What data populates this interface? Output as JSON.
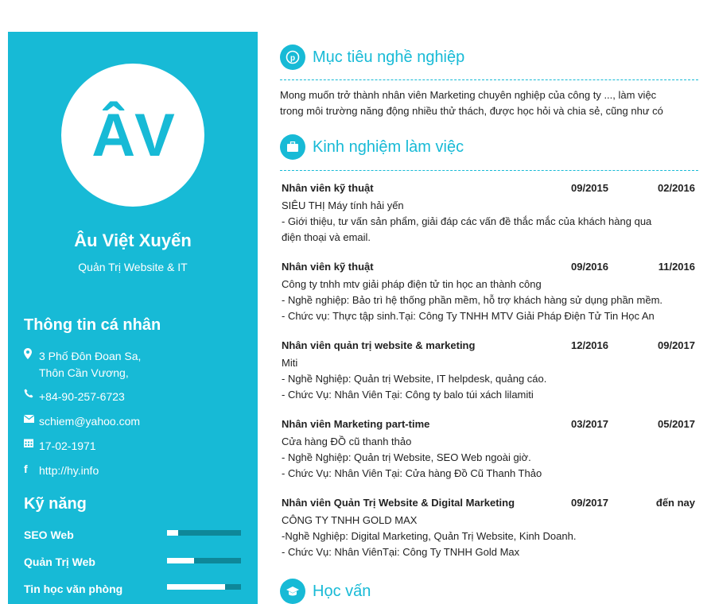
{
  "profile": {
    "initials": "ÂV",
    "name": "Âu Việt Xuyến",
    "role": "Quản Trị Website & IT"
  },
  "personal": {
    "heading": "Thông tin cá nhân",
    "address_line1": "3 Phố Đôn Đoan Sa,",
    "address_line2": "Thôn Cần Vương,",
    "phone": "+84-90-257-6723",
    "email": "schiem@yahoo.com",
    "birthday": "17-02-1971",
    "website": "http://hy.info"
  },
  "skills": {
    "heading": "Kỹ năng",
    "items": [
      {
        "label": "SEO Web",
        "level": 0.15
      },
      {
        "label": "Quản Trị Web",
        "level": 0.37
      },
      {
        "label": "Tin học văn phòng",
        "level": 0.78
      }
    ]
  },
  "objective": {
    "title": "Mục tiêu nghề nghiệp",
    "line1": "Mong muốn trở thành nhân viên Marketing chuyên nghiệp của công ty ..., làm việc",
    "line2": "trong môi trường năng động nhiều thử thách, được học hỏi và chia sẻ, cũng như có"
  },
  "experience": {
    "title": "Kinh nghiệm làm việc",
    "jobs": [
      {
        "title": "Nhân viên kỹ thuật",
        "start": "09/2015",
        "end": "02/2016",
        "lines": [
          "SIÊU THỊ Máy tính hải yến",
          "- Giới thiệu, tư vấn sản phẩm, giải đáp các vấn đề thắc mắc của khách hàng qua",
          "điện thoại và email."
        ]
      },
      {
        "title": "Nhân viên kỹ thuật",
        "start": "09/2016",
        "end": "11/2016",
        "lines": [
          "Công ty tnhh mtv giải pháp điện tử tin học an thành công",
          "- Nghề nghiệp: Bảo trì hệ thống phần mềm, hỗ trợ khách hàng sử dụng phần mềm.",
          "- Chức vụ: Thực tập sinh.Tại: Công Ty TNHH MTV Giải Pháp Điện Tử Tin Học An"
        ]
      },
      {
        "title": "Nhân viên quản trị website & marketing",
        "start": "12/2016",
        "end": "09/2017",
        "lines": [
          "Miti",
          "- Nghề Nghiệp: Quản trị Website, IT helpdesk, quảng cáo.",
          "- Chức Vụ: Nhân Viên Tại: Công ty balo túi xách lilamiti"
        ]
      },
      {
        "title": "Nhân viên Marketing part-time",
        "start": "03/2017",
        "end": "05/2017",
        "lines": [
          "Cửa hàng ĐỒ cũ thanh thảo",
          "- Nghề Nghiệp: Quản trị Website, SEO Web ngoài giờ.",
          "- Chức Vụ: Nhân Viên Tại: Cửa hàng Đồ Cũ Thanh Thảo"
        ]
      },
      {
        "title": "Nhân viên Quản Trị Website & Digital Marketing",
        "start": "09/2017",
        "end": "đến nay",
        "lines": [
          "CÔNG TY TNHH GOLD MAX",
          "-Nghề Nghiệp: Digital Marketing, Quản Trị Website, Kinh Doanh.",
          "- Chức Vụ: Nhân ViênTại: Công Ty TNHH Gold Max"
        ]
      }
    ]
  },
  "education": {
    "title": "Học vấn"
  },
  "colors": {
    "accent": "#17bad6",
    "bar_track": "#0e8799"
  },
  "icons": {
    "objective": "pinterest-icon",
    "experience": "briefcase-icon",
    "education": "graduation-cap-icon",
    "address": "map-marker-icon",
    "phone": "phone-icon",
    "email": "envelope-icon",
    "birthday": "calendar-icon",
    "website": "facebook-icon"
  }
}
